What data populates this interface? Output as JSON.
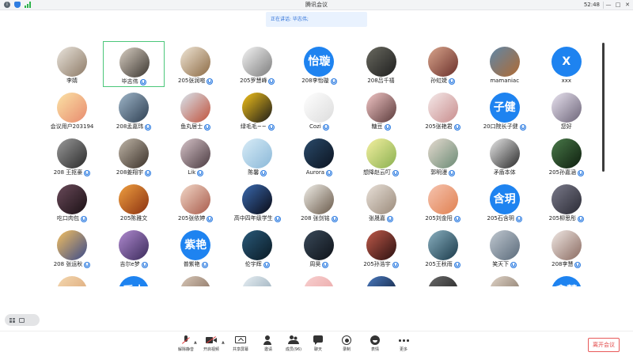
{
  "window": {
    "title": "腾讯会议",
    "time": "52:48",
    "controls": [
      "—",
      "□",
      "✕"
    ]
  },
  "speaking": {
    "text": "正在讲话: 毕志伟;"
  },
  "participants": [
    {
      "name": "李婧",
      "mic": false,
      "avatar": "photo",
      "c1": "#e9e4dc",
      "c2": "#8d7a66"
    },
    {
      "name": "毕志伟",
      "mic": true,
      "avatar": "photo",
      "c1": "#d8cfc2",
      "c2": "#3b3530",
      "active": true
    },
    {
      "name": "205张润喧",
      "mic": true,
      "avatar": "photo",
      "c1": "#f0e6d6",
      "c2": "#8c6a44"
    },
    {
      "name": "205罗慧峰",
      "mic": true,
      "avatar": "photo",
      "c1": "#f4f4f4",
      "c2": "#7d7d7d"
    },
    {
      "name": "208李怡璇",
      "mic": true,
      "avatar": "text",
      "label": "怡璇"
    },
    {
      "name": "208吕千禧",
      "mic": false,
      "avatar": "photo",
      "c1": "#6a6a60",
      "c2": "#1e1e1e"
    },
    {
      "name": "孙虹婕",
      "mic": true,
      "avatar": "photo",
      "c1": "#d9a58c",
      "c2": "#6a2f2a"
    },
    {
      "name": "mamaniac",
      "mic": false,
      "avatar": "photo",
      "c1": "#5f87a8",
      "c2": "#b06a32"
    },
    {
      "name": "xxx",
      "mic": false,
      "avatar": "text",
      "label": "X"
    },
    {
      "name": "会议用户203194",
      "mic": false,
      "avatar": "photo",
      "c1": "#fbe3a6",
      "c2": "#e88a6e"
    },
    {
      "name": "208孟嘉玮",
      "mic": true,
      "avatar": "photo",
      "c1": "#9fb6c9",
      "c2": "#2e3f52"
    },
    {
      "name": "鱼丸居士",
      "mic": true,
      "avatar": "photo",
      "c1": "#d8e6ef",
      "c2": "#c0503a"
    },
    {
      "name": "绿毛毛~~",
      "mic": true,
      "avatar": "photo",
      "c1": "#f3c21a",
      "c2": "#1a1a1a"
    },
    {
      "name": "Cozi",
      "mic": true,
      "avatar": "photo",
      "c1": "#ffffff",
      "c2": "#dcdcdc"
    },
    {
      "name": "糖豆",
      "mic": true,
      "avatar": "photo",
      "c1": "#f2c6c6",
      "c2": "#5a3a3a"
    },
    {
      "name": "205张艳君",
      "mic": true,
      "avatar": "photo",
      "c1": "#f5eaea",
      "c2": "#c88c8c"
    },
    {
      "name": "20口院长子健",
      "mic": true,
      "avatar": "text",
      "label": "子健"
    },
    {
      "name": "您好",
      "mic": false,
      "avatar": "photo",
      "c1": "#e9e3f0",
      "c2": "#6c6478"
    },
    {
      "name": "208 王抠豪",
      "mic": true,
      "avatar": "photo",
      "c1": "#9a9a9a",
      "c2": "#2a2a2a"
    },
    {
      "name": "208姜翔宇",
      "mic": true,
      "avatar": "photo",
      "c1": "#c0b6a8",
      "c2": "#3a3028"
    },
    {
      "name": "Lik",
      "mic": true,
      "avatar": "photo",
      "c1": "#d6c3c8",
      "c2": "#4a3a40"
    },
    {
      "name": "陈馨",
      "mic": true,
      "avatar": "photo",
      "c1": "#d8ecf7",
      "c2": "#8ab8d8"
    },
    {
      "name": "Aurora",
      "mic": true,
      "avatar": "photo",
      "c1": "#2a4a6a",
      "c2": "#0c1420"
    },
    {
      "name": "想降赵云叮",
      "mic": true,
      "avatar": "photo",
      "c1": "#f4f0a0",
      "c2": "#8ab050"
    },
    {
      "name": "郭明漫",
      "mic": true,
      "avatar": "photo",
      "c1": "#e6dbd0",
      "c2": "#6a8a74"
    },
    {
      "name": "矛盾本体",
      "mic": false,
      "avatar": "photo",
      "c1": "#e8e8e8",
      "c2": "#2a2a2a"
    },
    {
      "name": "205孙嘉涵",
      "mic": true,
      "avatar": "photo",
      "c1": "#4a7a4a",
      "c2": "#0e1e0e"
    },
    {
      "name": "吃口肉包",
      "mic": true,
      "avatar": "photo",
      "c1": "#6a4a5a",
      "c2": "#1a1014"
    },
    {
      "name": "205陈雅文",
      "mic": false,
      "avatar": "photo",
      "c1": "#f0a040",
      "c2": "#8a3010"
    },
    {
      "name": "205张依婷",
      "mic": true,
      "avatar": "photo",
      "c1": "#f2d8c8",
      "c2": "#a85a4a"
    },
    {
      "name": "高中四年级学生",
      "mic": true,
      "avatar": "photo",
      "c1": "#3a6ab0",
      "c2": "#0a0a14"
    },
    {
      "name": "208 张剑铭",
      "mic": true,
      "avatar": "photo",
      "c1": "#f0eee8",
      "c2": "#6a5a4a"
    },
    {
      "name": "张晟嘉",
      "mic": true,
      "avatar": "photo",
      "c1": "#e8e0d8",
      "c2": "#9a8a7a"
    },
    {
      "name": "205刘金阳",
      "mic": true,
      "avatar": "photo",
      "c1": "#f6c4b0",
      "c2": "#e08050"
    },
    {
      "name": "205石含玥",
      "mic": true,
      "avatar": "text",
      "label": "含玥"
    },
    {
      "name": "205柳思彤",
      "mic": true,
      "avatar": "photo",
      "c1": "#7a7a8a",
      "c2": "#2a2a34"
    },
    {
      "name": "208 张运秋",
      "mic": true,
      "avatar": "photo",
      "c1": "#f4c060",
      "c2": "#3a4a8a"
    },
    {
      "name": "吉尔e梦",
      "mic": true,
      "avatar": "photo",
      "c1": "#b08ad0",
      "c2": "#3a2a5a"
    },
    {
      "name": "普紫艳",
      "mic": true,
      "avatar": "text",
      "label": "紫艳"
    },
    {
      "name": "伦宇辉",
      "mic": true,
      "avatar": "photo",
      "c1": "#2a5a7a",
      "c2": "#0a1a24"
    },
    {
      "name": "周昊",
      "mic": true,
      "avatar": "photo",
      "c1": "#3a4a5a",
      "c2": "#0e1218"
    },
    {
      "name": "205孙浩宇",
      "mic": true,
      "avatar": "photo",
      "c1": "#c05a4a",
      "c2": "#2a1010"
    },
    {
      "name": "205王秋雨",
      "mic": true,
      "avatar": "photo",
      "c1": "#8ab0c0",
      "c2": "#1a3a4a"
    },
    {
      "name": "笑天下",
      "mic": true,
      "avatar": "photo",
      "c1": "#c0c8d0",
      "c2": "#5a6a7a"
    },
    {
      "name": "208李慧",
      "mic": true,
      "avatar": "photo",
      "c1": "#f0e8e4",
      "c2": "#8a6a60"
    },
    {
      "name": "",
      "mic": false,
      "avatar": "photo",
      "c1": "#f4d8b0",
      "c2": "#d8a070"
    },
    {
      "name": "",
      "mic": false,
      "avatar": "text",
      "label": "乔木"
    },
    {
      "name": "",
      "mic": false,
      "avatar": "photo",
      "c1": "#d8c8b8",
      "c2": "#7a6050"
    },
    {
      "name": "",
      "mic": false,
      "avatar": "photo",
      "c1": "#e8f0f4",
      "c2": "#8aa0b0"
    },
    {
      "name": "",
      "mic": false,
      "avatar": "photo",
      "c1": "#f8d0d0",
      "c2": "#e8a0a0"
    },
    {
      "name": "",
      "mic": false,
      "avatar": "photo",
      "c1": "#4a7ac0",
      "c2": "#0a1428"
    },
    {
      "name": "",
      "mic": false,
      "avatar": "photo",
      "c1": "#6a6a6a",
      "c2": "#1a1a1a"
    },
    {
      "name": "",
      "mic": false,
      "avatar": "photo",
      "c1": "#e0d4c8",
      "c2": "#7a6a5a"
    },
    {
      "name": "",
      "mic": false,
      "avatar": "text",
      "label": "鑫慧"
    }
  ],
  "toolbar": {
    "unmute": "解除静音",
    "start_video": "开启视频",
    "share_screen": "共享屏幕",
    "invite": "邀请",
    "members": "成员(96)",
    "chat": "聊天",
    "record": "录制",
    "emoji": "表情",
    "more": "更多",
    "leave": "离开会议"
  },
  "colors": {
    "accent": "#1e83f0",
    "active_border": "#4bc77a",
    "leave": "#e24a4a"
  }
}
